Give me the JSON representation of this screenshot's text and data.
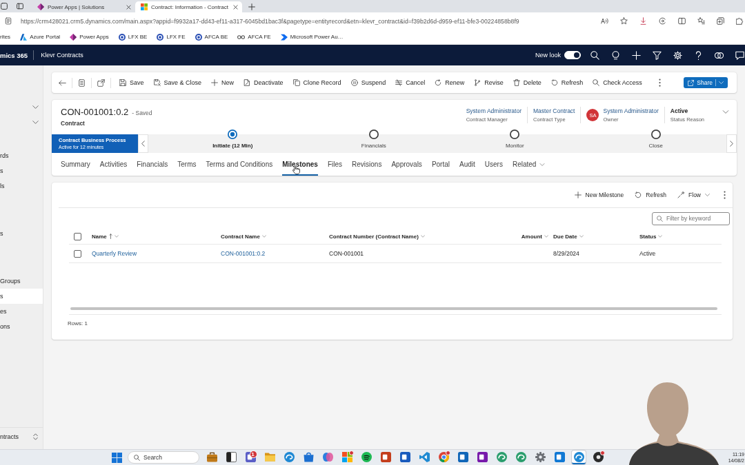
{
  "browser": {
    "tabs": [
      {
        "title": "Power Apps | Solutions",
        "kind": "powerapps",
        "selected": false
      },
      {
        "title": "Contract: Information - Contract",
        "kind": "microsoft",
        "selected": true
      }
    ],
    "address": "https://crm428021.crm5.dynamics.com/main.aspx?appid=f9932a17-dd43-ef11-a317-6045bd1bac3f&pagetype=entityrecord&etn=klevr_contract&id=f39b2d6d-d959-ef11-bfe3-00224858b8f9",
    "bookmarks": [
      {
        "label": "rites",
        "kind": "plain"
      },
      {
        "label": "Azure Portal",
        "kind": "azure"
      },
      {
        "label": "Power Apps",
        "kind": "powerapps"
      },
      {
        "label": "LFX BE",
        "kind": "site"
      },
      {
        "label": "LFX FE",
        "kind": "site"
      },
      {
        "label": "AFCA BE",
        "kind": "site"
      },
      {
        "label": "AFCA FE",
        "kind": "link"
      },
      {
        "label": "Microsoft Power Au…",
        "kind": "automate"
      }
    ]
  },
  "app_bar": {
    "product": "mics 365",
    "area": "Klevr Contracts",
    "new_look": {
      "label": "New look",
      "on": true
    }
  },
  "sidebar": {
    "sections": [
      {
        "expanded": false
      },
      {
        "expanded": false
      }
    ],
    "groups": [
      {
        "items": [
          {
            "label": "rds",
            "selected": false
          },
          {
            "label": "s",
            "selected": false
          },
          {
            "label": "ls",
            "selected": false
          }
        ]
      },
      {
        "items": [
          {
            "label": "s",
            "selected": false
          }
        ]
      },
      {
        "items": [
          {
            "label": "Groups",
            "selected": false
          },
          {
            "label": "s",
            "selected": true
          },
          {
            "label": "es",
            "selected": false
          },
          {
            "label": "ons",
            "selected": false
          }
        ]
      }
    ],
    "area_switcher": "ntracts"
  },
  "command_bar": {
    "commands": [
      {
        "label": "Save",
        "kind": "save"
      },
      {
        "label": "Save & Close",
        "kind": "saveclose"
      },
      {
        "label": "New",
        "kind": "new"
      },
      {
        "label": "Deactivate",
        "kind": "deactivate"
      },
      {
        "label": "Clone Record",
        "kind": "clone"
      },
      {
        "label": "Suspend",
        "kind": "suspend"
      },
      {
        "label": "Cancel",
        "kind": "cancel"
      },
      {
        "label": "Renew",
        "kind": "renew"
      },
      {
        "label": "Revise",
        "kind": "revise"
      },
      {
        "label": "Delete",
        "kind": "delete"
      },
      {
        "label": "Refresh",
        "kind": "refresh"
      },
      {
        "label": "Check Access",
        "kind": "access"
      }
    ],
    "share": "Share"
  },
  "record": {
    "title": "CON-001001:0.2",
    "save_status": "- Saved",
    "entity": "Contract",
    "fields": [
      {
        "value": "System Administrator",
        "label": "Contract Manager",
        "kind": "link"
      },
      {
        "value": "Master Contract",
        "label": "Contract Type",
        "kind": "link"
      },
      {
        "value": "System Administrator",
        "label": "Owner",
        "kind": "owner",
        "initials": "SA"
      },
      {
        "value": "Active",
        "label": "Status Reason",
        "kind": "plain"
      }
    ]
  },
  "process": {
    "name": "Contract Business Process",
    "duration": "Active for 12 minutes",
    "stages": [
      {
        "label": "Initiate (12 Min)",
        "selected": true
      },
      {
        "label": "Financials",
        "selected": false
      },
      {
        "label": "Monitor",
        "selected": false
      },
      {
        "label": "Close",
        "selected": false
      }
    ]
  },
  "tabs": [
    {
      "label": "Summary",
      "kind": "tab",
      "selected": false
    },
    {
      "label": "Activities",
      "kind": "tab",
      "selected": false
    },
    {
      "label": "Financials",
      "kind": "tab",
      "selected": false
    },
    {
      "label": "Terms",
      "kind": "tab",
      "selected": false
    },
    {
      "label": "Terms and Conditions",
      "kind": "tab",
      "selected": false
    },
    {
      "label": "Milestones",
      "kind": "tab",
      "selected": true
    },
    {
      "label": "Files",
      "kind": "tab",
      "selected": false
    },
    {
      "label": "Revisions",
      "kind": "tab",
      "selected": false
    },
    {
      "label": "Approvals",
      "kind": "tab",
      "selected": false
    },
    {
      "label": "Portal",
      "kind": "tab",
      "selected": false
    },
    {
      "label": "Audit",
      "kind": "tab",
      "selected": false
    },
    {
      "label": "Users",
      "kind": "tab",
      "selected": false
    },
    {
      "label": "Related",
      "kind": "menu",
      "selected": false
    }
  ],
  "milestones": {
    "commands": [
      {
        "label": "New Milestone",
        "kind": "add"
      },
      {
        "label": "Refresh",
        "kind": "refresh"
      },
      {
        "label": "Flow",
        "kind": "flow"
      }
    ],
    "filter": {
      "placeholder": "Filter by keyword"
    },
    "all_selected": false,
    "columns": [
      {
        "label": "Name",
        "kind": "link",
        "sorted": true
      },
      {
        "label": "Contract Name",
        "kind": "link",
        "sorted": false
      },
      {
        "label": "Contract Number (Contract Name)",
        "kind": "text",
        "sorted": false
      },
      {
        "label": "Amount",
        "kind": "number",
        "sorted": false
      },
      {
        "label": "Due Date",
        "kind": "text",
        "sorted": false
      },
      {
        "label": "Status",
        "kind": "text",
        "sorted": false
      }
    ],
    "rows": [
      {
        "selected": false,
        "name": "Quarterly Review",
        "contract_name": "CON-001001:0.2",
        "contract_number": "CON-001001",
        "due_date": "8/29/2024",
        "status": "Active"
      }
    ],
    "row_count": "Rows: 1"
  },
  "taskbar": {
    "search": {
      "placeholder": "Search"
    },
    "apps": [
      {
        "kind": "briefcase",
        "active": false,
        "notified": false
      },
      {
        "kind": "window",
        "active": false,
        "notified": false
      },
      {
        "kind": "tile",
        "color": "#5b5fc7",
        "active": false,
        "notified": true,
        "badge": "1"
      },
      {
        "kind": "folder",
        "active": false,
        "notified": false
      },
      {
        "kind": "browser",
        "color": "#1e88d4",
        "active": false,
        "notified": false
      },
      {
        "kind": "bag",
        "active": false,
        "notified": false
      },
      {
        "kind": "loop",
        "active": false,
        "notified": false
      },
      {
        "kind": "tiles",
        "active": false,
        "notified": true
      },
      {
        "kind": "disc",
        "active": false,
        "notified": false
      },
      {
        "kind": "tile",
        "color": "#c43e1c",
        "active": false,
        "notified": false
      },
      {
        "kind": "tile",
        "color": "#185abd",
        "active": false,
        "notified": false
      },
      {
        "kind": "ribbon",
        "active": false,
        "notified": false
      },
      {
        "kind": "segments",
        "active": false,
        "notified": true
      },
      {
        "kind": "tile",
        "color": "#1066b8",
        "active": false,
        "notified": false
      },
      {
        "kind": "tile",
        "color": "#7719aa",
        "active": false,
        "notified": false
      },
      {
        "kind": "browser",
        "color": "#2b9e6e",
        "active": false,
        "notified": false
      },
      {
        "kind": "browser",
        "color": "#2b9e6e",
        "active": false,
        "notified": false
      },
      {
        "kind": "gear",
        "active": false,
        "notified": false
      },
      {
        "kind": "tile",
        "color": "#0f78d4",
        "active": false,
        "notified": false
      },
      {
        "kind": "browser",
        "color": "#1e88d4",
        "active": true,
        "notified": false
      },
      {
        "kind": "dot",
        "active": false,
        "notified": true
      }
    ],
    "clock": {
      "time": "11:19",
      "date": "14/08/2"
    }
  }
}
